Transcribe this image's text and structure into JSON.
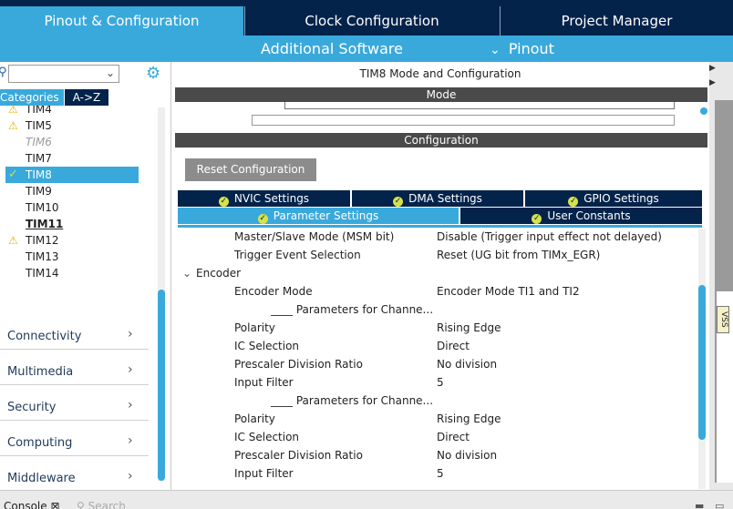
{
  "top_tabs": {
    "pinout": "Pinout & Configuration",
    "clock": "Clock Configuration",
    "project": "Project Manager"
  },
  "subbar": {
    "additional": "Additional Software",
    "pinout": "Pinout"
  },
  "left": {
    "categories_tab": "Categories",
    "az_tab": "A->Z",
    "timers": [
      {
        "label": "TIM4",
        "state": "warning"
      },
      {
        "label": "TIM5",
        "state": "warning"
      },
      {
        "label": "TIM6",
        "state": "disabled"
      },
      {
        "label": "TIM7",
        "state": "normal"
      },
      {
        "label": "TIM8",
        "state": "selected"
      },
      {
        "label": "TIM9",
        "state": "normal"
      },
      {
        "label": "TIM10",
        "state": "normal"
      },
      {
        "label": "TIM11",
        "state": "bold"
      },
      {
        "label": "TIM12",
        "state": "warning"
      },
      {
        "label": "TIM13",
        "state": "normal"
      },
      {
        "label": "TIM14",
        "state": "normal"
      }
    ],
    "categories": [
      "Connectivity",
      "Multimedia",
      "Security",
      "Computing",
      "Middleware"
    ]
  },
  "center": {
    "title": "TIM8 Mode and Configuration",
    "mode_header": "Mode",
    "config_header": "Configuration",
    "reset_button": "Reset Configuration",
    "tabs_row1": [
      "NVIC Settings",
      "DMA Settings",
      "GPIO Settings"
    ],
    "tabs_row2": [
      "Parameter Settings",
      "User Constants"
    ],
    "params": [
      {
        "name": "Master/Slave Mode (MSM bit)",
        "value": "Disable (Trigger input effect not delayed)"
      },
      {
        "name": "Trigger Event Selection",
        "value": "Reset (UG bit from TIMx_EGR)"
      },
      {
        "group": "Encoder"
      },
      {
        "name": "Encoder Mode",
        "value": "Encoder Mode TI1 and TI2"
      },
      {
        "name": "____ Parameters for Channe...",
        "value": "",
        "sub": true
      },
      {
        "name": "Polarity",
        "value": "Rising Edge"
      },
      {
        "name": "IC Selection",
        "value": "Direct"
      },
      {
        "name": "Prescaler Division Ratio",
        "value": "No division"
      },
      {
        "name": "Input Filter",
        "value": "5"
      },
      {
        "name": "____ Parameters for Channe...",
        "value": "",
        "sub": true
      },
      {
        "name": "Polarity",
        "value": "Rising Edge"
      },
      {
        "name": "IC Selection",
        "value": "Direct"
      },
      {
        "name": "Prescaler Division Ratio",
        "value": "No division"
      },
      {
        "name": "Input Filter",
        "value": "5"
      }
    ]
  },
  "right": {
    "pin_label": "VSS"
  },
  "bottom": {
    "console": "Console",
    "search": "Search"
  },
  "colors": {
    "accent": "#39a9dc",
    "navy": "#03234b"
  }
}
